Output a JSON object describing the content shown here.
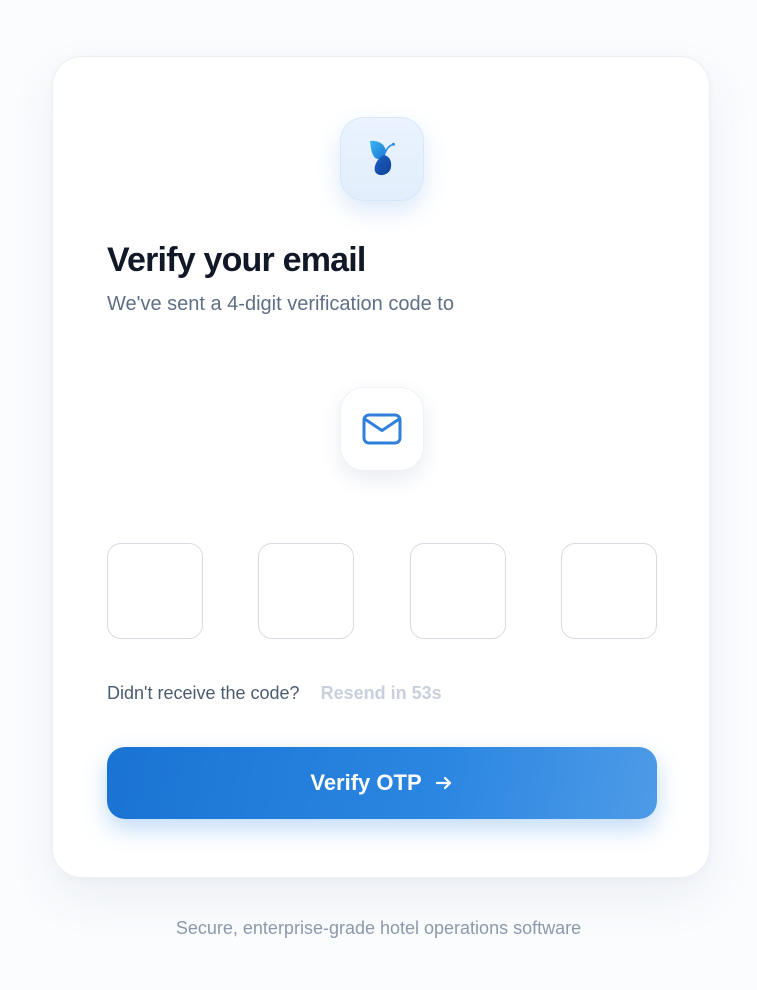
{
  "brand": {
    "logo_icon": "butterfly-logo-icon",
    "accent_color": "#1f77d8"
  },
  "header": {
    "title": "Verify your email",
    "subtitle": "We've sent a 4-digit verification code to"
  },
  "mail_icon": "envelope-icon",
  "otp": {
    "digits": [
      {
        "value": ""
      },
      {
        "value": ""
      },
      {
        "value": ""
      },
      {
        "value": ""
      }
    ]
  },
  "resend": {
    "question": "Didn't receive the code?",
    "countdown_label": "Resend in 53s"
  },
  "actions": {
    "verify_label": "Verify OTP",
    "verify_icon": "arrow-right-icon"
  },
  "footer": {
    "text": "Secure, enterprise-grade hotel operations software"
  }
}
